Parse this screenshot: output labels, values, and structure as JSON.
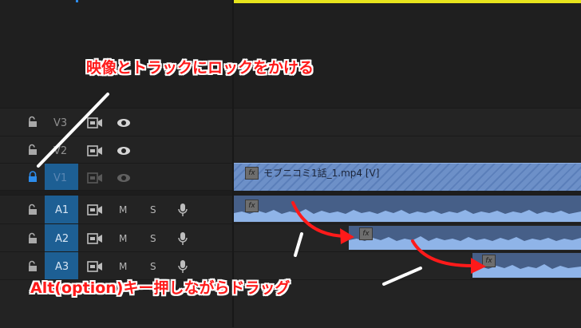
{
  "tracks": {
    "video": [
      {
        "label": "V3",
        "locked": false
      },
      {
        "label": "V2",
        "locked": false
      },
      {
        "label": "V1",
        "locked": true
      }
    ],
    "audio": [
      {
        "label": "A1",
        "mute": "M",
        "solo": "S"
      },
      {
        "label": "A2",
        "mute": "M",
        "solo": "S"
      },
      {
        "label": "A3",
        "mute": "M",
        "solo": "S"
      }
    ]
  },
  "clip": {
    "video_name": "モブニコミ1話_1.mp4 [V]",
    "fx": "fx"
  },
  "annotations": {
    "top": "映像とトラックにロックをかける",
    "bottom": "Alt(option)キー押しながらドラッグ"
  },
  "colors": {
    "annotation_red": "#ff1a1a",
    "target_blue": "#1d5f94",
    "lock_blue": "#2d8ceb",
    "clip_blue": "#5b7fba",
    "playhead_yellow": "#e7e41d"
  },
  "icons": [
    "lock-icon",
    "unlock-icon",
    "camera-icon",
    "eye-icon",
    "microphone-icon",
    "fx-badge"
  ]
}
